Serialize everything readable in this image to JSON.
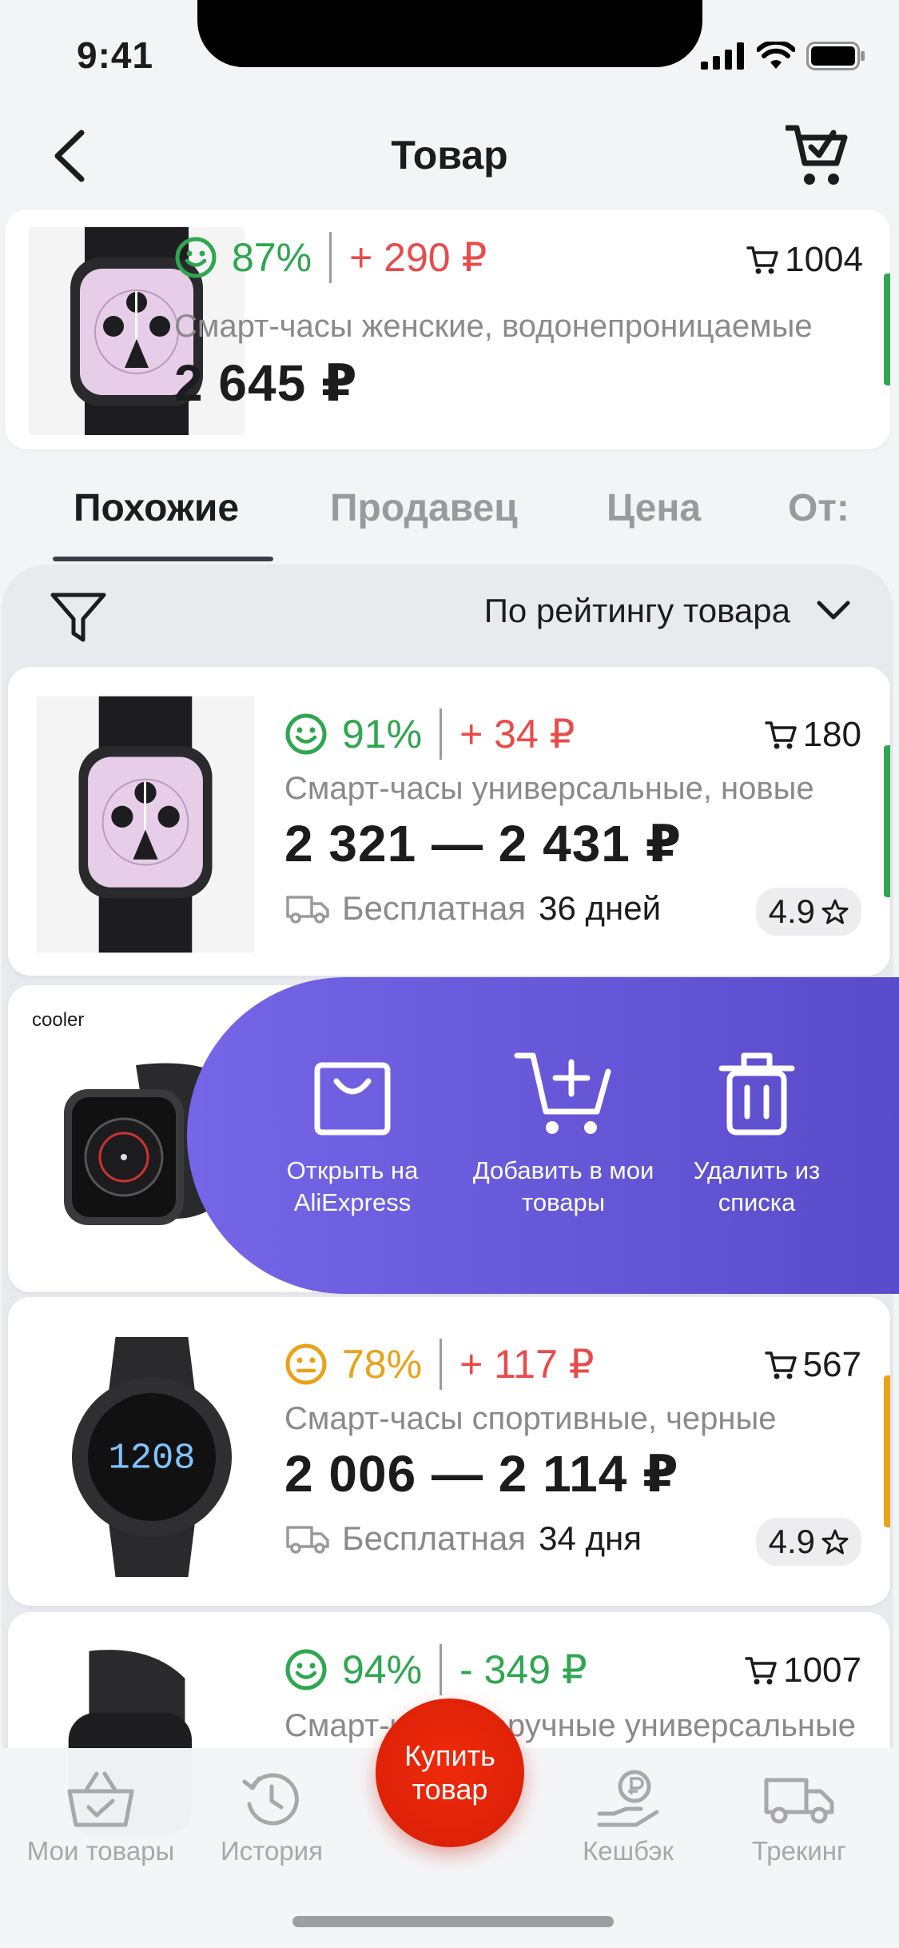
{
  "status": {
    "time": "9:41"
  },
  "nav": {
    "title": "Товар"
  },
  "hero": {
    "score": "87%",
    "delta": "+ 290 ₽",
    "orders": "1004",
    "title": "Смарт-часы женские, водонепроницаемые",
    "price": "2 645 ₽",
    "accent": "#2fa650"
  },
  "tabs": [
    "Похожие",
    "Продавец",
    "Цена",
    "От:"
  ],
  "sort": {
    "label": "По рейтингу товара"
  },
  "items": [
    {
      "score": "91%",
      "score_color": "#2fa650",
      "mood": "happy",
      "delta": "+ 34 ₽",
      "delta_color": "#e94b4b",
      "orders": "180",
      "title": "Смарт-часы универсальные, новые",
      "price": "2 321 — 2 431 ₽",
      "shipping": "Бесплатная",
      "days": "36 дней",
      "rating": "4.9",
      "edge": "#2fa650"
    },
    {
      "brand": "cooler"
    },
    {
      "score": "78%",
      "score_color": "#e9a21a",
      "mood": "neutral",
      "delta": "+ 117 ₽",
      "delta_color": "#e94b4b",
      "orders": "567",
      "title": "Смарт-часы спортивные, черные",
      "price": "2 006 — 2 114 ₽",
      "shipping": "Бесплатная",
      "days": "34 дня",
      "rating": "4.9",
      "edge": "#e9a21a"
    },
    {
      "score": "94%",
      "score_color": "#2fa650",
      "mood": "happy",
      "delta": "- 349 ₽",
      "delta_color": "#2fa650",
      "orders": "1007",
      "title": "Смарт-часы наручные универсальные"
    }
  ],
  "swipe_actions": [
    {
      "label": "Открыть на AliExpress",
      "icon": "bag-icon"
    },
    {
      "label": "Добавить в мои товары",
      "icon": "cart-plus-icon"
    },
    {
      "label": "Удалить из списка",
      "icon": "trash-icon"
    }
  ],
  "tabbar": {
    "items": [
      "Мои товары",
      "История",
      "Кешбэк",
      "Трекинг"
    ],
    "buy": "Купить товар"
  }
}
